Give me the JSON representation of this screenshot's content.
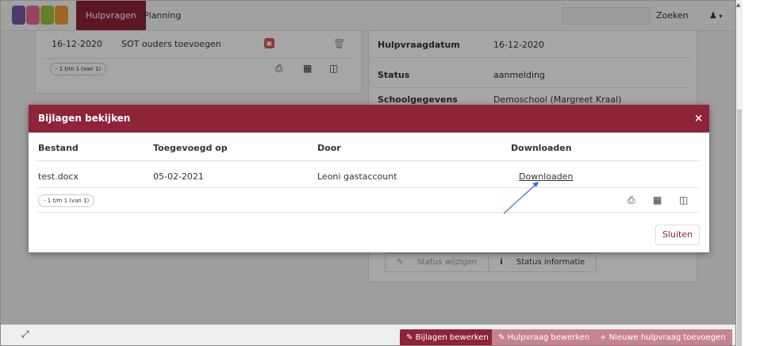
{
  "nav": {
    "tabs": [
      {
        "label": "Hulpvragen",
        "active": true
      },
      {
        "label": "Planning",
        "active": false
      }
    ],
    "search_placeholder": "",
    "search_button": "Zoeken",
    "user_icon": "user-icon"
  },
  "left_card": {
    "row": {
      "date": "16-12-2020",
      "title": "SOT ouders toevoegen"
    },
    "pager": "- 1 t/m 1 (van 1)"
  },
  "right_card": {
    "fields": [
      {
        "label": "Hulpvraagdatum",
        "value": "16-12-2020"
      },
      {
        "label": "Status",
        "value": "aanmelding"
      },
      {
        "label": "Schoolgegevens",
        "value": "Demoschool (Margreet Kraal)"
      }
    ],
    "status_change": "Status wijzigen",
    "status_info": "Status informatie"
  },
  "modal": {
    "title": "Bijlagen bekijken",
    "close_symbol": "×",
    "columns": [
      "Bestand",
      "Toegevoegd op",
      "Door",
      "Downloaden"
    ],
    "rows": [
      {
        "file": "test.docx",
        "date": "05-02-2021",
        "by": "Leoni gastaccount",
        "download": "Downloaden"
      }
    ],
    "pager": "- 1 t/m 1 (van 1)",
    "close_button": "Sluiten"
  },
  "bottom_bar": {
    "edit_attachments": "Bijlagen bewerken",
    "edit_request": "Hulpvraag bewerken",
    "new_request": "Nieuwe hulpvraag toevoegen"
  },
  "colors": {
    "brand": "#8f2338",
    "annotation_arrow": "#3b6fd6"
  }
}
